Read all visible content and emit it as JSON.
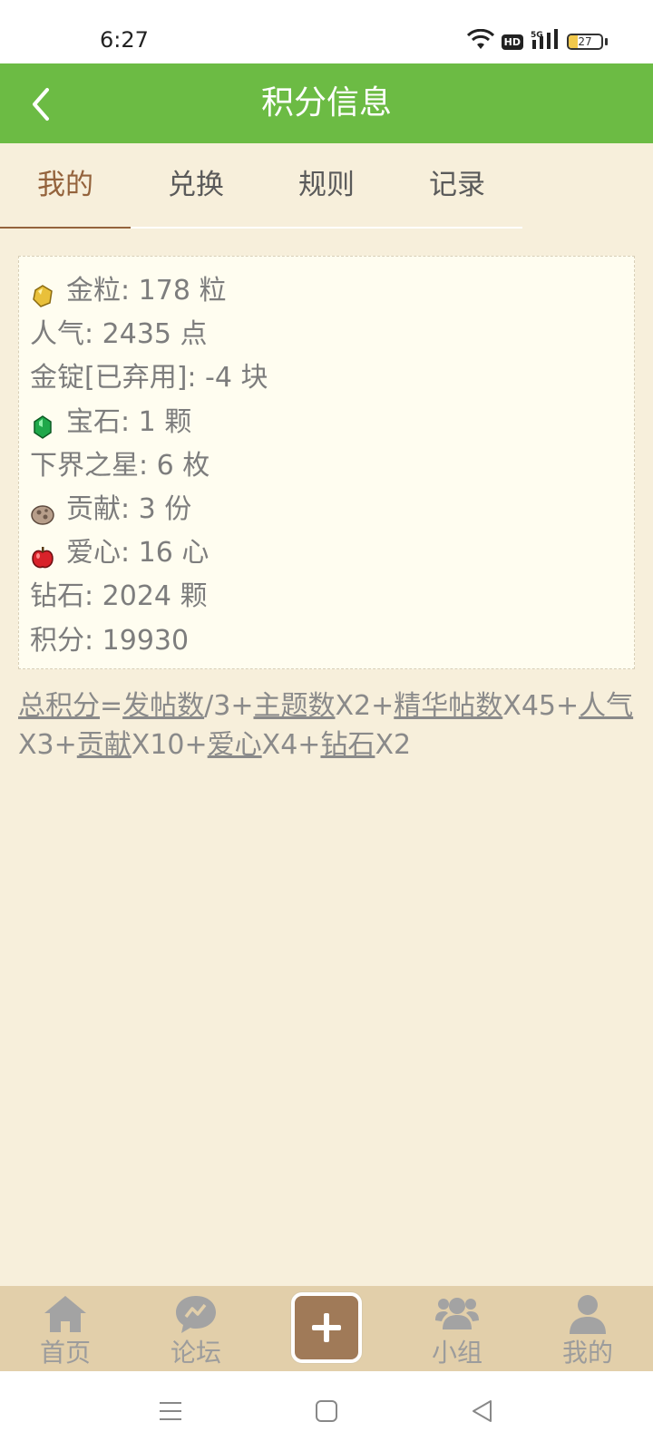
{
  "status_bar": {
    "time": "6:27",
    "hd_label": "HD",
    "network": "5G",
    "battery": "27",
    "battery_level_percent": 27
  },
  "header": {
    "title": "积分信息"
  },
  "tabs": [
    {
      "label": "我的",
      "active": true
    },
    {
      "label": "兑换",
      "active": false
    },
    {
      "label": "规则",
      "active": false
    },
    {
      "label": "记录",
      "active": false
    }
  ],
  "stats": [
    {
      "text": "金粒: 178 粒",
      "icon": "gold-grain-icon"
    },
    {
      "text": "人气: 2435 点"
    },
    {
      "text": "金锭[已弃用]: -4 块"
    },
    {
      "text": "宝石: 1 颗",
      "icon": "gem-icon"
    },
    {
      "text": "下界之星: 6 枚"
    },
    {
      "text": "贡献: 3 份",
      "icon": "contribution-icon"
    },
    {
      "text": "爱心: 16 心",
      "icon": "apple-heart-icon"
    },
    {
      "text": "钻石: 2024 颗"
    },
    {
      "text": "积分: 19930"
    }
  ],
  "formula": {
    "total": "总积分",
    "eq": "=",
    "posts": "发帖数",
    "t1": "/3+",
    "topics": "主题数",
    "t2": "X2+",
    "digest": "精华帖数",
    "t3": "X45+",
    "popularity": "人气",
    "t4": "X3+",
    "contribution": "贡献",
    "t5": "X10+",
    "love": "爱心",
    "t6": "X4+",
    "diamond": "钻石",
    "t7": "X2"
  },
  "bottom_nav": [
    {
      "label": "首页",
      "icon": "home-icon"
    },
    {
      "label": "论坛",
      "icon": "forum-icon"
    },
    {
      "label": "",
      "icon": "plus-icon"
    },
    {
      "label": "小组",
      "icon": "group-icon"
    },
    {
      "label": "我的",
      "icon": "profile-icon"
    }
  ],
  "colors": {
    "header_bg": "#6cbb44",
    "page_bg": "#f7efdb",
    "card_bg": "#fffdf0",
    "active_tab": "#94633c",
    "nav_bg": "#e2cfaa",
    "plus_btn": "#a07a58"
  }
}
